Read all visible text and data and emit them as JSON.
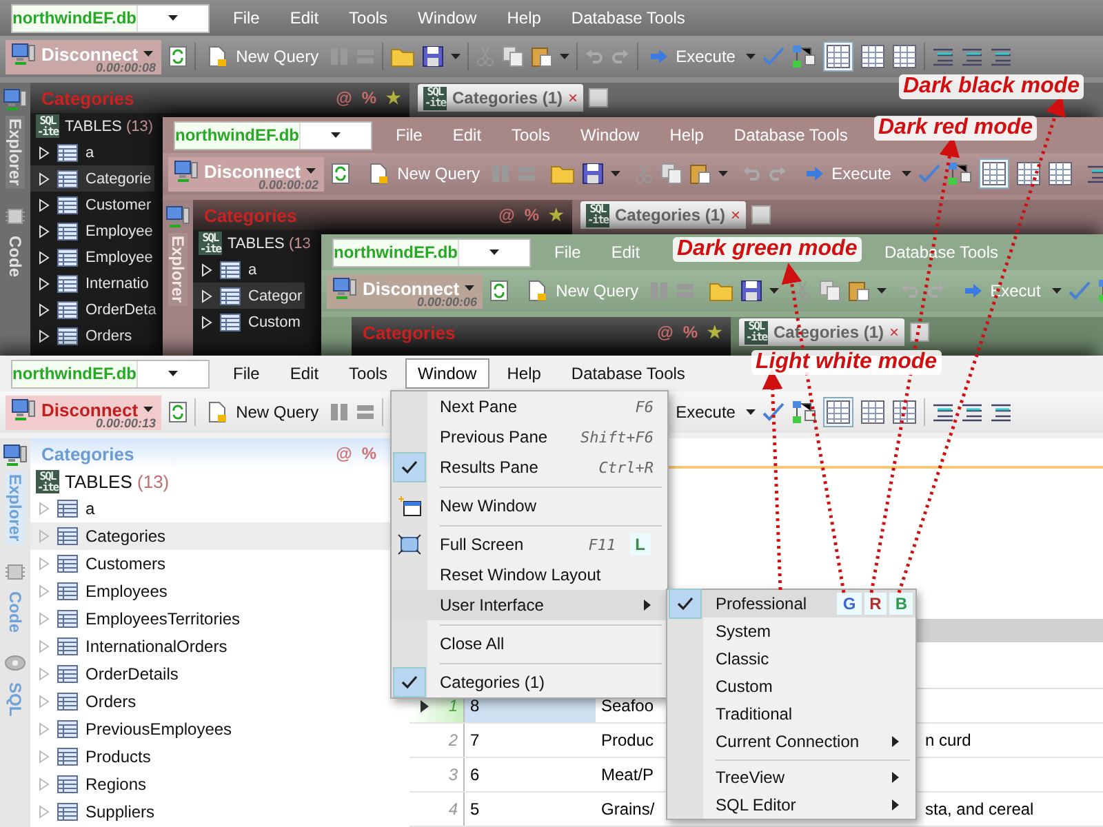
{
  "windows": [
    {
      "database": "northwindEF.db",
      "menu": [
        {
          "label": "File",
          "selected": false
        },
        {
          "label": "Edit",
          "selected": false
        },
        {
          "label": "Tools",
          "selected": false
        },
        {
          "label": "Window",
          "selected": false
        },
        {
          "label": "Help",
          "selected": false
        },
        {
          "label": "Database Tools",
          "selected": false
        }
      ],
      "disconnect": "Disconnect",
      "timer": "0.00:00:08",
      "new_query": "New Query",
      "execute": "Execute",
      "side_tabs": [
        {
          "label": "Explorer",
          "selected": true
        },
        {
          "label": "Code",
          "selected": false
        }
      ],
      "panel": {
        "title": "Categories",
        "marks": [
          "@",
          "%",
          "★"
        ]
      },
      "document_tab": {
        "logo": [
          "SQL",
          "-ite"
        ],
        "label": "Categories (1)",
        "close": "×"
      },
      "tables": {
        "logo": [
          "SQL",
          "-ite"
        ],
        "label": "TABLES",
        "count": "(13)"
      },
      "tree": [
        {
          "label": "a",
          "selected": false
        },
        {
          "label": "Categorie",
          "selected": true
        },
        {
          "label": "Customer",
          "selected": false
        },
        {
          "label": "Employee",
          "selected": false
        },
        {
          "label": "Employee",
          "selected": false
        },
        {
          "label": "Internatio",
          "selected": false
        },
        {
          "label": "OrderDeta",
          "selected": false
        },
        {
          "label": "Orders",
          "selected": false
        }
      ]
    },
    {
      "database": "northwindEF.db",
      "menu": [
        {
          "label": "File",
          "selected": false
        },
        {
          "label": "Edit",
          "selected": false
        },
        {
          "label": "Tools",
          "selected": false
        },
        {
          "label": "Window",
          "selected": false
        },
        {
          "label": "Help",
          "selected": false
        },
        {
          "label": "Database Tools",
          "selected": false
        }
      ],
      "disconnect": "Disconnect",
      "timer": "0.00:00:02",
      "new_query": "New Query",
      "execute": "Execute",
      "side_tabs": [
        {
          "label": "Explorer",
          "selected": true
        }
      ],
      "panel": {
        "title": "Categories",
        "marks": [
          "@",
          "%",
          "★"
        ]
      },
      "document_tab": {
        "logo": [
          "SQL",
          "-ite"
        ],
        "label": "Categories (1)",
        "close": "×"
      },
      "tables": {
        "logo": [
          "SQL",
          "-ite"
        ],
        "label": "TABLES",
        "count": "(13"
      },
      "tree": [
        {
          "label": "a",
          "selected": false
        },
        {
          "label": "Categor",
          "selected": true
        },
        {
          "label": "Custom",
          "selected": false
        }
      ]
    },
    {
      "database": "northwindEF.db",
      "menu": [
        {
          "label": "File",
          "selected": false
        },
        {
          "label": "Edit",
          "selected": false
        },
        {
          "label": "Database Tools",
          "selected": false
        }
      ],
      "disconnect": "Disconnect",
      "timer": "0.00:00:06",
      "new_query": "New Query",
      "execute": "Execut",
      "panel": {
        "title": "Categories",
        "marks": [
          "@",
          "%",
          "★"
        ]
      },
      "document_tab": {
        "logo": [
          "SQL",
          "-ite"
        ],
        "label": "Categories (1)",
        "close": "×"
      }
    },
    {
      "database": "northwindEF.db",
      "menu": [
        {
          "label": "File",
          "selected": false
        },
        {
          "label": "Edit",
          "selected": false
        },
        {
          "label": "Tools",
          "selected": false
        },
        {
          "label": "Window",
          "selected": true
        },
        {
          "label": "Help",
          "selected": false
        },
        {
          "label": "Database Tools",
          "selected": false
        }
      ],
      "disconnect": "Disconnect",
      "timer": "0.00:00:13",
      "new_query": "New Query",
      "execute": "Execute",
      "side_tabs": [
        {
          "label": "Explorer",
          "selected": true
        },
        {
          "label": "Code",
          "selected": false
        },
        {
          "label": "SQL",
          "selected": false
        }
      ],
      "panel": {
        "title": "Categories",
        "marks": [
          "@",
          "%"
        ]
      },
      "tables": {
        "logo": [
          "SQL",
          "-ite"
        ],
        "label": "TABLES",
        "count": "(13)"
      },
      "tree": [
        {
          "label": "a",
          "selected": false
        },
        {
          "label": "Categories",
          "selected": true
        },
        {
          "label": "Customers",
          "selected": false
        },
        {
          "label": "Employees",
          "selected": false
        },
        {
          "label": "EmployeesTerritories",
          "selected": false
        },
        {
          "label": "InternationalOrders",
          "selected": false
        },
        {
          "label": "OrderDetails",
          "selected": false
        },
        {
          "label": "Orders",
          "selected": false
        },
        {
          "label": "PreviousEmployees",
          "selected": false
        },
        {
          "label": "Products",
          "selected": false
        },
        {
          "label": "Regions",
          "selected": false
        },
        {
          "label": "Suppliers",
          "selected": false
        }
      ],
      "grid": {
        "rows": [
          {
            "number": "1",
            "selected": true,
            "id": "8",
            "name": "Seafoo"
          },
          {
            "number": "2",
            "selected": false,
            "id": "7",
            "name": "Produc",
            "description": "n curd"
          },
          {
            "number": "3",
            "selected": false,
            "id": "6",
            "name": "Meat/P"
          },
          {
            "number": "4",
            "selected": false,
            "id": "5",
            "name": "Grains/",
            "description": "sta, and cereal"
          }
        ]
      },
      "window_menu": {
        "items": [
          {
            "kind": "plain",
            "label": "Next Pane",
            "shortcut": "F6",
            "checked": false,
            "selected": false
          },
          {
            "kind": "plain",
            "label": "Previous Pane",
            "shortcut": "Shift+F6",
            "checked": false,
            "selected": false
          },
          {
            "kind": "plain",
            "label": "Results Pane",
            "shortcut": "Ctrl+R",
            "checked": true,
            "selected": false
          },
          {
            "kind": "separator"
          },
          {
            "kind": "window",
            "label": "New Window",
            "checked": false,
            "selected": false
          },
          {
            "kind": "separator"
          },
          {
            "kind": "screen",
            "label": "Full Screen",
            "shortcut": "F11",
            "badge": "L",
            "checked": false,
            "selected": false
          },
          {
            "kind": "plain",
            "label": "Reset Window Layout",
            "checked": false,
            "selected": false
          },
          {
            "kind": "submenu",
            "label": "User Interface",
            "checked": false,
            "selected": true
          },
          {
            "kind": "separator"
          },
          {
            "kind": "plain",
            "label": "Close All",
            "checked": false,
            "selected": false
          },
          {
            "kind": "separator"
          },
          {
            "kind": "plain",
            "label": "Categories (1)",
            "checked": true,
            "selected": false
          }
        ],
        "submenu": [
          {
            "kind": "plain",
            "label": "Professional",
            "checked": true,
            "selected": true,
            "badges": [
              {
                "label": "G",
                "color": "#3a66d6"
              },
              {
                "label": "R",
                "color": "#b03030"
              },
              {
                "label": "B",
                "color": "#2f9a4c"
              }
            ]
          },
          {
            "kind": "plain",
            "label": "System",
            "checked": false,
            "selected": false
          },
          {
            "kind": "plain",
            "label": "Classic",
            "checked": false,
            "selected": false
          },
          {
            "kind": "plain",
            "label": "Custom",
            "checked": false,
            "selected": false
          },
          {
            "kind": "plain",
            "label": "Traditional",
            "checked": false,
            "selected": false
          },
          {
            "kind": "submenu",
            "label": "Current Connection",
            "checked": false,
            "selected": false
          },
          {
            "kind": "separator"
          },
          {
            "kind": "submenu",
            "label": "TreeView",
            "checked": false,
            "selected": false
          },
          {
            "kind": "submenu",
            "label": "SQL Editor",
            "checked": false,
            "selected": false
          }
        ]
      }
    }
  ],
  "annotations": [
    {
      "label": "Dark black mode"
    },
    {
      "label": "Dark red mode"
    },
    {
      "label": "Dark green mode"
    },
    {
      "label": "Light white mode"
    }
  ]
}
